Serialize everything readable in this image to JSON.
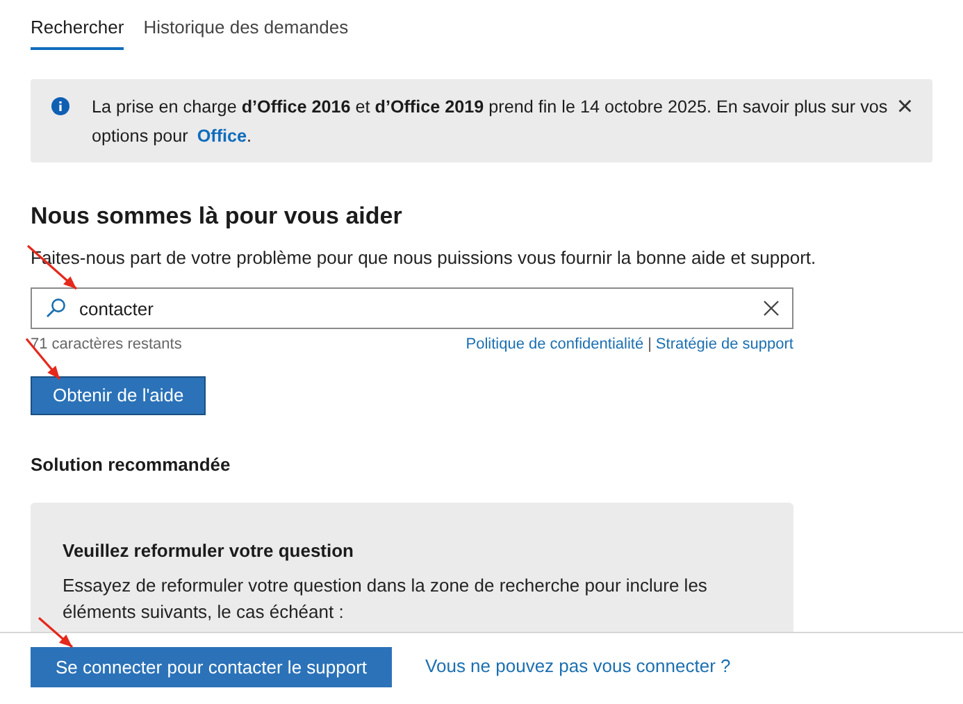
{
  "tabs": [
    {
      "label": "Rechercher",
      "selected": true
    },
    {
      "label": "Historique des demandes",
      "selected": false
    }
  ],
  "banner": {
    "text": "La prise en charge **d’Office 2016** et **d’Office 2019** prend fin le 14 octobre 2025. En savoir plus sur vos options pour",
    "link": "Office",
    "text_after": ".",
    "close": "×"
  },
  "help": {
    "heading": "Nous sommes là pour vous aider",
    "description": "Faites-nous part de votre problème pour que nous puissions vous fournir la bonne aide et support.",
    "search": {
      "value": "contacter"
    },
    "remaining": "71 caractères restants",
    "links": [
      "Politique de confidentialité",
      "Stratégie de support"
    ],
    "separator": "|",
    "button": "Obtenir de l'aide"
  },
  "solution": {
    "heading": "Solution recommandée",
    "card_title": "Veuillez reformuler votre question",
    "card_text": "Essayez de reformuler votre question dans la zone de recherche pour inclure les éléments suivants, le cas échéant :"
  },
  "footer": {
    "button": "Se connecter pour contacter le support",
    "link": "Vous ne pouvez pas vous connecter ?"
  }
}
